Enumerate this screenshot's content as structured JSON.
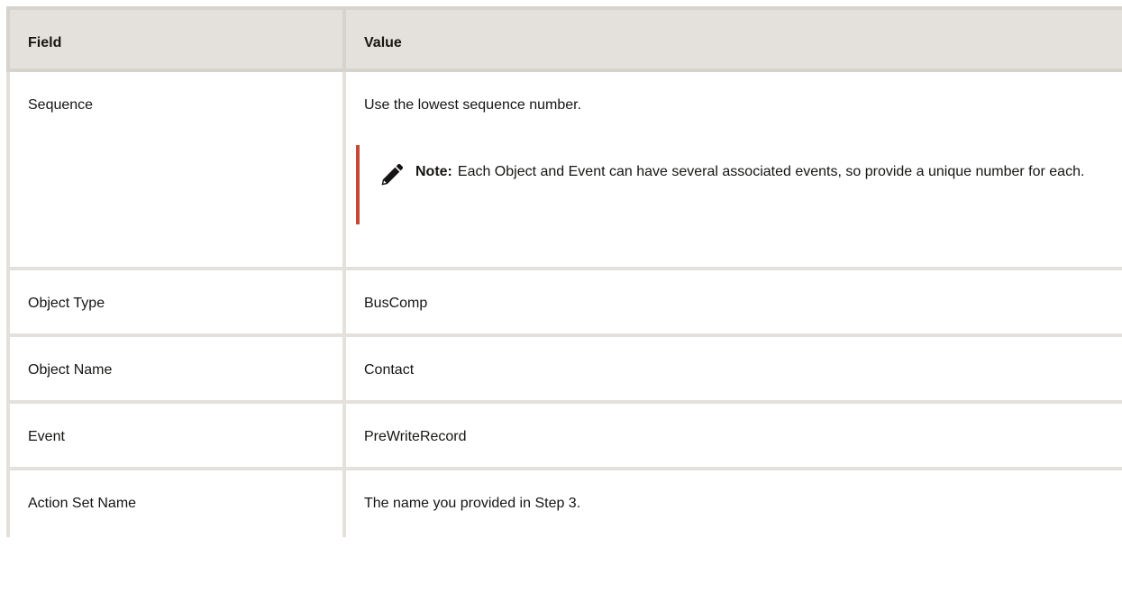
{
  "table": {
    "headers": {
      "field": "Field",
      "value": "Value"
    },
    "rows": [
      {
        "field": "Sequence",
        "value": "Use the lowest sequence number.",
        "note": {
          "label": "Note:",
          "text": "Each Object and Event can have several associated events, so provide a unique number for each.",
          "icon": "pencil-icon"
        }
      },
      {
        "field": "Object Type",
        "value": "BusComp"
      },
      {
        "field": "Object Name",
        "value": "Contact"
      },
      {
        "field": "Event",
        "value": "PreWriteRecord"
      },
      {
        "field": "Action Set Name",
        "value": "The name you provided in Step 3."
      }
    ]
  },
  "colors": {
    "header_bg": "#e4e1dc",
    "border": "#e4e1dc",
    "note_accent": "#c74634",
    "text": "#161513"
  }
}
